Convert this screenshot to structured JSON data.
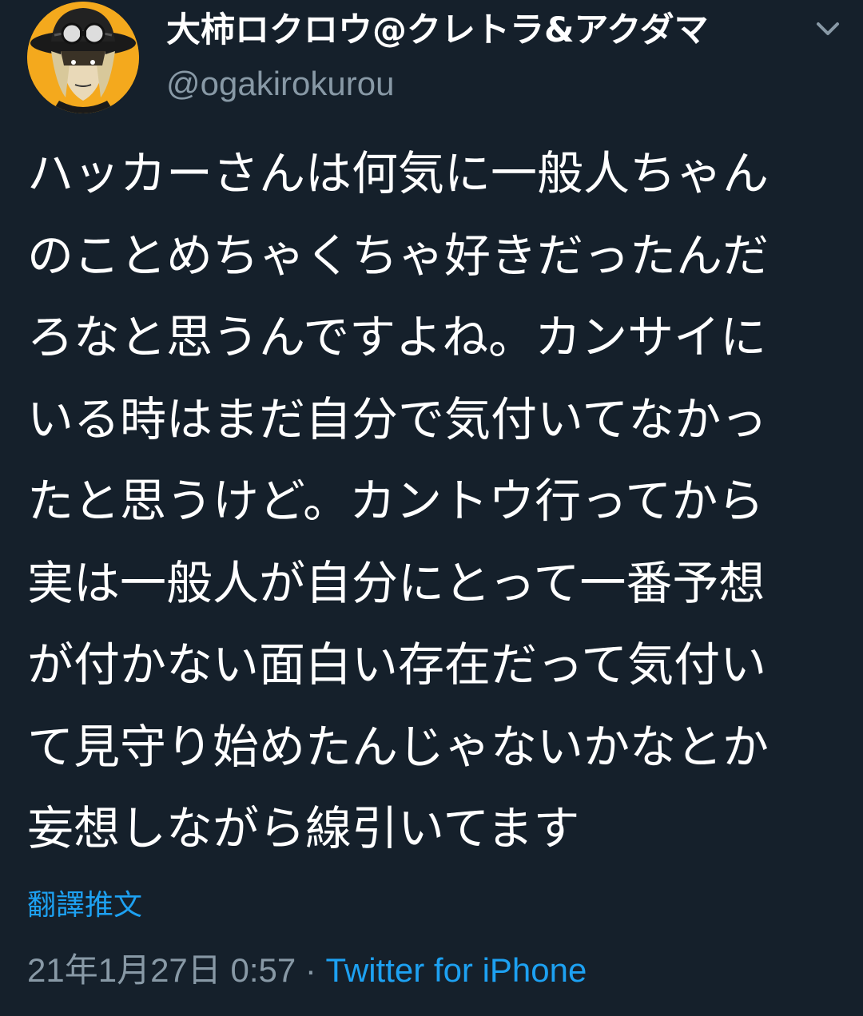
{
  "author": {
    "display_name": "大柿ロクロウ@クレトラ&アクダマ",
    "handle": "@ogakirokurou",
    "avatar_icon": "avatar-illustration"
  },
  "tweet": {
    "lines": [
      "ハッカーさんは何気に一般人ちゃん",
      "のことめちゃくちゃ好きだったんだ",
      "ろなと思うんですよね。カンサイに",
      "いる時はまだ自分で気付いてなかっ",
      "たと思うけど。カントウ行ってから",
      "実は一般人が自分にとって一番予想",
      "が付かない面白い存在だって気付い",
      "て見守り始めたんじゃないかなとか",
      "妄想しながら線引いてます"
    ],
    "translate_label": "翻譯推文",
    "timestamp": "21年1月27日 0:57",
    "separator": " · ",
    "source": "Twitter for iPhone"
  },
  "menu": {
    "icon": "chevron-down-icon"
  },
  "colors": {
    "background": "#15202b",
    "primary_text": "#ffffff",
    "secondary_text": "#8899a6",
    "accent": "#1da1f2"
  }
}
